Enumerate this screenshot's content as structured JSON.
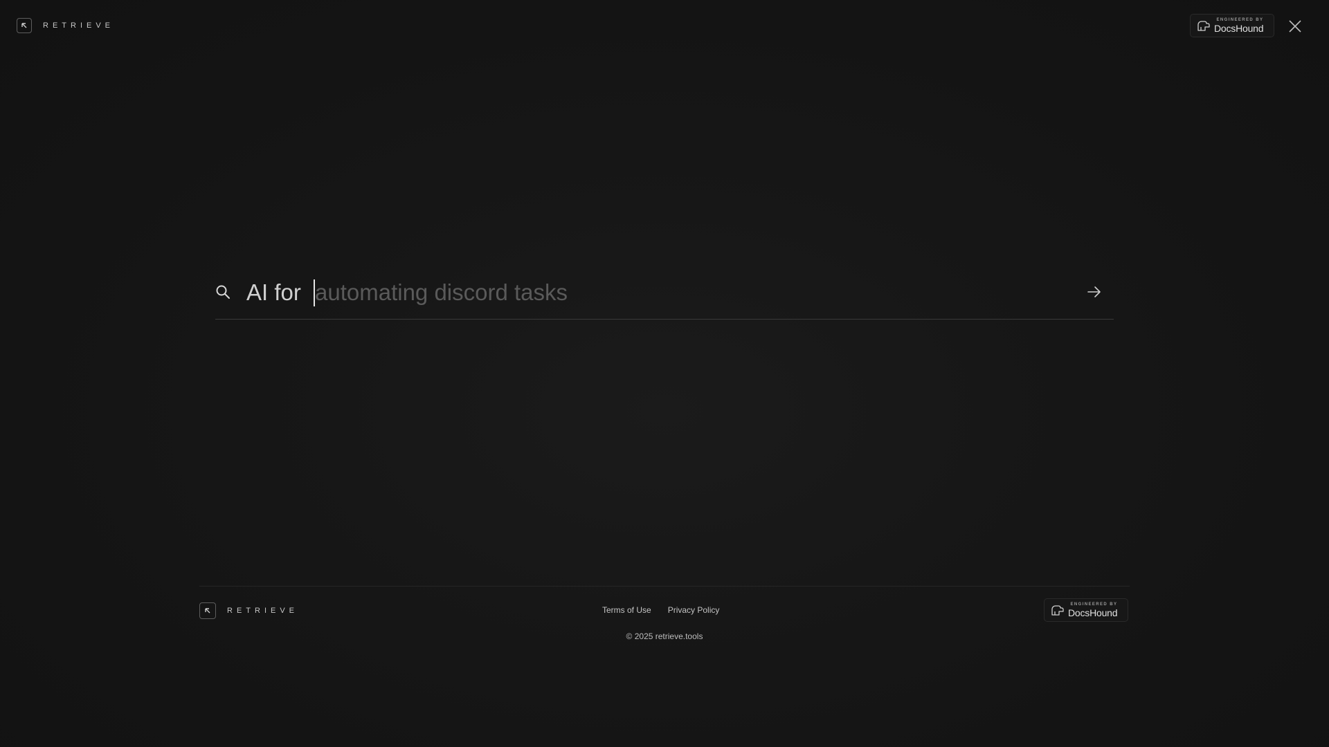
{
  "brand": {
    "name": "RETRIEVE"
  },
  "badge": {
    "small_text": "ENGINEERED BY",
    "name": "DocsHound"
  },
  "search": {
    "prefix": "AI for",
    "value": "",
    "placeholder": "automating discord tasks"
  },
  "footer": {
    "links": [
      "Terms of Use",
      "Privacy Policy"
    ],
    "copyright": "© 2025 retrieve.tools"
  },
  "icons": {
    "brand": "arrow-up-left-icon",
    "badge": "docshound-logo-icon",
    "close": "close-icon",
    "search": "search-icon",
    "submit": "arrow-right-icon"
  },
  "colors": {
    "background": "#141414",
    "text": "#d9d9d9",
    "placeholder": "#5a5a5a",
    "divider": "#3a3a3a"
  }
}
